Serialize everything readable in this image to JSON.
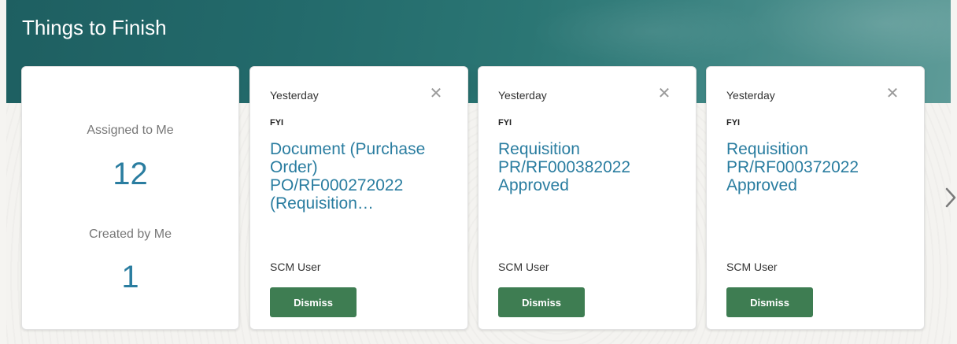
{
  "header": {
    "title": "Things to Finish"
  },
  "summary": {
    "assigned_label": "Assigned to Me",
    "assigned_count": "12",
    "created_label": "Created by Me",
    "created_count": "1"
  },
  "cards": [
    {
      "date": "Yesterday",
      "type": "FYI",
      "title": "Document (Purchase Order) PO/RF000272022 (Requisition…",
      "user": "SCM User",
      "dismiss_label": "Dismiss"
    },
    {
      "date": "Yesterday",
      "type": "FYI",
      "title": "Requisition PR/RF000382022 Approved",
      "user": "SCM User",
      "dismiss_label": "Dismiss"
    },
    {
      "date": "Yesterday",
      "type": "FYI",
      "title": "Requisition PR/RF000372022 Approved",
      "user": "SCM User",
      "dismiss_label": "Dismiss"
    }
  ],
  "icons": {
    "close": "close-icon",
    "next": "chevron-right-icon"
  },
  "colors": {
    "header_bg": "#236a6b",
    "link": "#2a7da0",
    "dismiss_bg": "#3e7d52"
  }
}
